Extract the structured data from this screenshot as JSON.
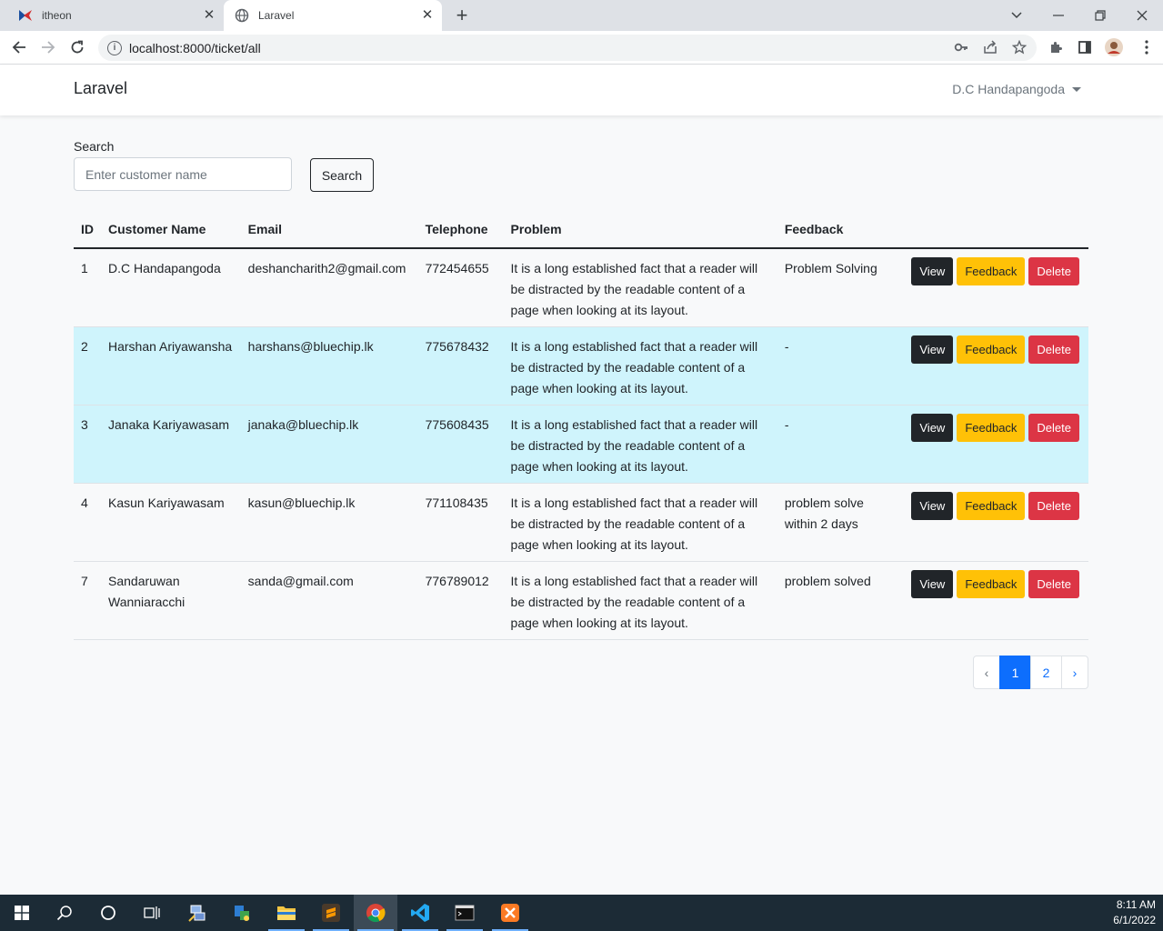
{
  "browser": {
    "tabs": [
      {
        "title": "itheon"
      },
      {
        "title": "Laravel"
      }
    ],
    "url": "localhost:8000/ticket/all"
  },
  "navbar": {
    "brand": "Laravel",
    "user": "D.C Handapangoda"
  },
  "search": {
    "label": "Search",
    "placeholder": "Enter customer name",
    "button": "Search"
  },
  "table": {
    "headers": [
      "ID",
      "Customer Name",
      "Email",
      "Telephone",
      "Problem",
      "Feedback",
      ""
    ],
    "rows": [
      {
        "id": "1",
        "name": "D.C Handapangoda",
        "email": "deshancharith2@gmail.com",
        "tel": "772454655",
        "problem": "It is a long established fact that a reader will be distracted by the readable content of a page when looking at its layout.",
        "feedback": "Problem Solving",
        "highlight": false
      },
      {
        "id": "2",
        "name": "Harshan Ariyawansha",
        "email": "harshans@bluechip.lk",
        "tel": "775678432",
        "problem": "It is a long established fact that a reader will be distracted by the readable content of a page when looking at its layout.",
        "feedback": "-",
        "highlight": true
      },
      {
        "id": "3",
        "name": "Janaka Kariyawasam",
        "email": "janaka@bluechip.lk",
        "tel": "775608435",
        "problem": "It is a long established fact that a reader will be distracted by the readable content of a page when looking at its layout.",
        "feedback": "-",
        "highlight": true
      },
      {
        "id": "4",
        "name": "Kasun Kariyawasam",
        "email": "kasun@bluechip.lk",
        "tel": "771108435",
        "problem": "It is a long established fact that a reader will be distracted by the readable content of a page when looking at its layout.",
        "feedback": "problem solve within 2 days",
        "highlight": false
      },
      {
        "id": "7",
        "name": "Sandaruwan Wanniaracchi",
        "email": "sanda@gmail.com",
        "tel": "776789012",
        "problem": "It is a long established fact that a reader will be distracted by the readable content of a page when looking at its layout.",
        "feedback": "problem solved",
        "highlight": false
      }
    ],
    "actions": {
      "view": "View",
      "feedback": "Feedback",
      "delete": "Delete"
    }
  },
  "pagination": {
    "prev": "‹",
    "pages": [
      "1",
      "2"
    ],
    "current": "1",
    "next": "›"
  },
  "taskbar": {
    "time": "8:11 AM",
    "date": "6/1/2022"
  },
  "colors": {
    "view": "#212529",
    "feedback": "#ffc107",
    "delete": "#dc3545",
    "row_highlight": "#cff4fc",
    "primary": "#0d6efd"
  }
}
